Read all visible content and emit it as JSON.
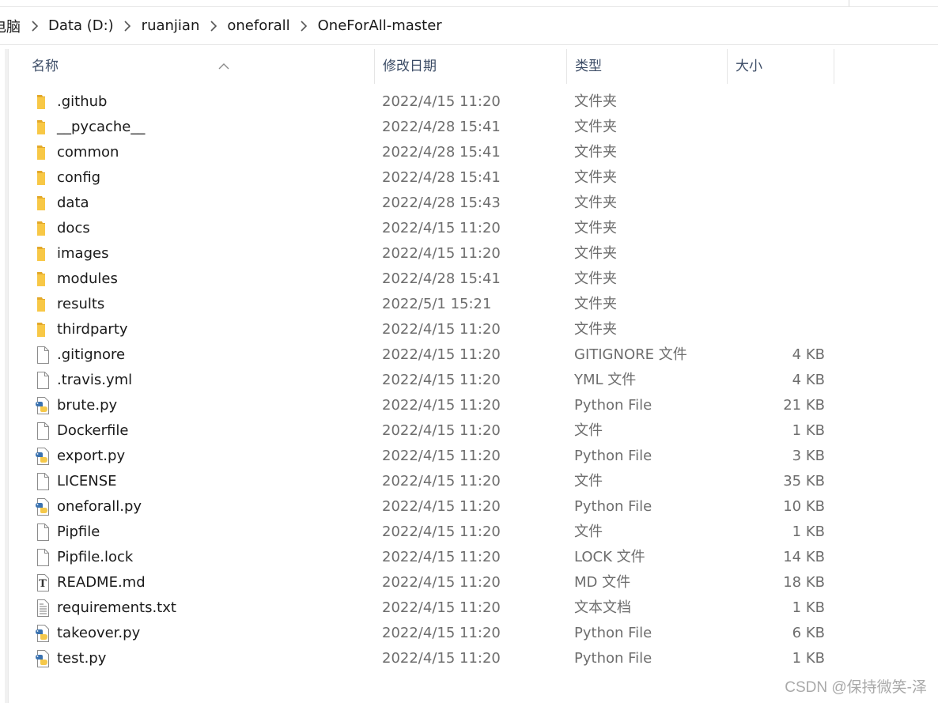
{
  "breadcrumb": [
    "电脑",
    "Data (D:)",
    "ruanjian",
    "oneforall",
    "OneForAll-master"
  ],
  "columns": {
    "name": "名称",
    "date": "修改日期",
    "type": "类型",
    "size": "大小"
  },
  "files": [
    {
      "name": ".github",
      "date": "2022/4/15 11:20",
      "type": "文件夹",
      "size": "",
      "icon": "folder-icon"
    },
    {
      "name": "__pycache__",
      "date": "2022/4/28 15:41",
      "type": "文件夹",
      "size": "",
      "icon": "folder-icon"
    },
    {
      "name": "common",
      "date": "2022/4/28 15:41",
      "type": "文件夹",
      "size": "",
      "icon": "folder-icon"
    },
    {
      "name": "config",
      "date": "2022/4/28 15:41",
      "type": "文件夹",
      "size": "",
      "icon": "folder-icon"
    },
    {
      "name": "data",
      "date": "2022/4/28 15:43",
      "type": "文件夹",
      "size": "",
      "icon": "folder-icon"
    },
    {
      "name": "docs",
      "date": "2022/4/15 11:20",
      "type": "文件夹",
      "size": "",
      "icon": "folder-icon"
    },
    {
      "name": "images",
      "date": "2022/4/15 11:20",
      "type": "文件夹",
      "size": "",
      "icon": "folder-icon"
    },
    {
      "name": "modules",
      "date": "2022/4/28 15:41",
      "type": "文件夹",
      "size": "",
      "icon": "folder-icon"
    },
    {
      "name": "results",
      "date": "2022/5/1 15:21",
      "type": "文件夹",
      "size": "",
      "icon": "folder-icon"
    },
    {
      "name": "thirdparty",
      "date": "2022/4/15 11:20",
      "type": "文件夹",
      "size": "",
      "icon": "folder-icon"
    },
    {
      "name": ".gitignore",
      "date": "2022/4/15 11:20",
      "type": "GITIGNORE 文件",
      "size": "4 KB",
      "icon": "blank-file-icon"
    },
    {
      "name": ".travis.yml",
      "date": "2022/4/15 11:20",
      "type": "YML 文件",
      "size": "4 KB",
      "icon": "blank-file-icon"
    },
    {
      "name": "brute.py",
      "date": "2022/4/15 11:20",
      "type": "Python File",
      "size": "21 KB",
      "icon": "python-file-icon"
    },
    {
      "name": "Dockerfile",
      "date": "2022/4/15 11:20",
      "type": "文件",
      "size": "1 KB",
      "icon": "blank-file-icon"
    },
    {
      "name": "export.py",
      "date": "2022/4/15 11:20",
      "type": "Python File",
      "size": "3 KB",
      "icon": "python-file-icon"
    },
    {
      "name": "LICENSE",
      "date": "2022/4/15 11:20",
      "type": "文件",
      "size": "35 KB",
      "icon": "blank-file-icon"
    },
    {
      "name": "oneforall.py",
      "date": "2022/4/15 11:20",
      "type": "Python File",
      "size": "10 KB",
      "icon": "python-file-icon"
    },
    {
      "name": "Pipfile",
      "date": "2022/4/15 11:20",
      "type": "文件",
      "size": "1 KB",
      "icon": "blank-file-icon"
    },
    {
      "name": "Pipfile.lock",
      "date": "2022/4/15 11:20",
      "type": "LOCK 文件",
      "size": "14 KB",
      "icon": "blank-file-icon"
    },
    {
      "name": "README.md",
      "date": "2022/4/15 11:20",
      "type": "MD 文件",
      "size": "18 KB",
      "icon": "markdown-file-icon"
    },
    {
      "name": "requirements.txt",
      "date": "2022/4/15 11:20",
      "type": "文本文档",
      "size": "1 KB",
      "icon": "text-file-icon"
    },
    {
      "name": "takeover.py",
      "date": "2022/4/15 11:20",
      "type": "Python File",
      "size": "6 KB",
      "icon": "python-file-icon"
    },
    {
      "name": "test.py",
      "date": "2022/4/15 11:20",
      "type": "Python File",
      "size": "1 KB",
      "icon": "python-file-icon"
    }
  ],
  "watermark": "CSDN @保持微笑-泽",
  "colors": {
    "folder": "#f8c846",
    "folder_dark": "#e3a92a",
    "python_blue": "#3a72b0",
    "python_yellow": "#f5c84a",
    "header_text": "#3c4c66",
    "secondary_text": "#6d6d6d"
  }
}
